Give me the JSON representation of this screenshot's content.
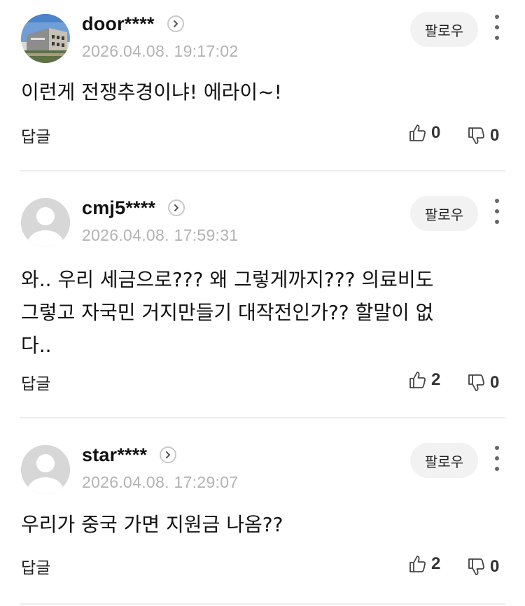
{
  "comments": [
    {
      "username": "door****",
      "timestamp": "2026.04.08. 19:17:02",
      "follow_label": "팔로우",
      "lines": [
        "이런게 전쟁추경이냐! 에라이~!"
      ],
      "reply_label": "답글",
      "likes": "0",
      "dislikes": "0",
      "avatar": "building-photo"
    },
    {
      "username": "cmj5****",
      "timestamp": "2026.04.08. 17:59:31",
      "follow_label": "팔로우",
      "lines": [
        "와.. 우리 세금으로??? 왜 그렇게까지??? 의료비도",
        "그렇고 자국민 거지만들기 대작전인가?? 할말이 없",
        "다.."
      ],
      "reply_label": "답글",
      "likes": "2",
      "dislikes": "0",
      "avatar": "default-user"
    },
    {
      "username": "star****",
      "timestamp": "2026.04.08. 17:29:07",
      "follow_label": "팔로우",
      "lines": [
        "우리가 중국 가면 지원금 나옴??"
      ],
      "reply_label": "답글",
      "likes": "2",
      "dislikes": "0",
      "avatar": "default-user"
    }
  ]
}
